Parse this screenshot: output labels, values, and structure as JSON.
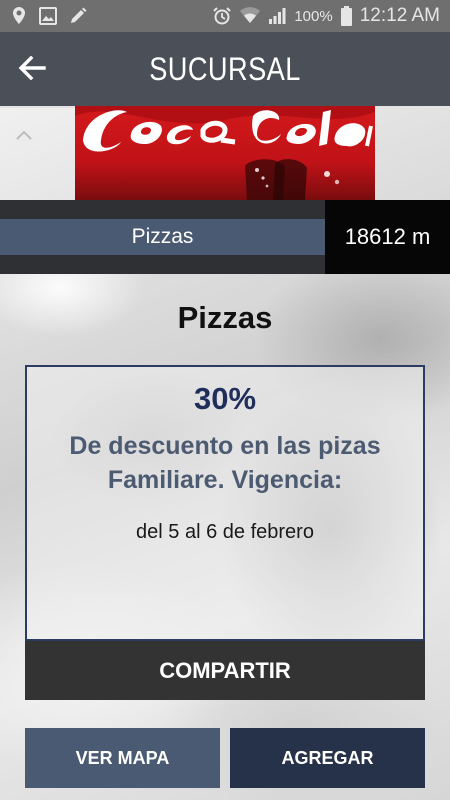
{
  "status_bar": {
    "battery_percent": "100%",
    "time": "12:12 AM",
    "icons": [
      "location-icon",
      "image-icon",
      "edit-icon",
      "alarm-icon",
      "wifi-icon",
      "signal-icon",
      "battery-icon"
    ]
  },
  "app_bar": {
    "title": "SUCURSAL",
    "back_icon": "arrow-left-icon"
  },
  "promo_image": {
    "brand_colors": {
      "red": "#d3191c",
      "white": "#ffffff"
    }
  },
  "category": {
    "label": "Pizzas",
    "distance": "18612 m"
  },
  "offer": {
    "title": "Pizzas",
    "discount": "30%",
    "description": "De descuento en las pizas Familiare. Vigencia:",
    "validity": "del 5 al 6 de febrero"
  },
  "actions": {
    "share_label": "COMPARTIR",
    "map_label": "VER MAPA",
    "add_label": "AGREGAR"
  },
  "colors": {
    "app_bar": "#4a4f58",
    "status_bar": "#6f6f6f",
    "accent_blue": "#4a5a73",
    "dark_navy": "#26324a",
    "discount_text": "#1f2e5a"
  }
}
